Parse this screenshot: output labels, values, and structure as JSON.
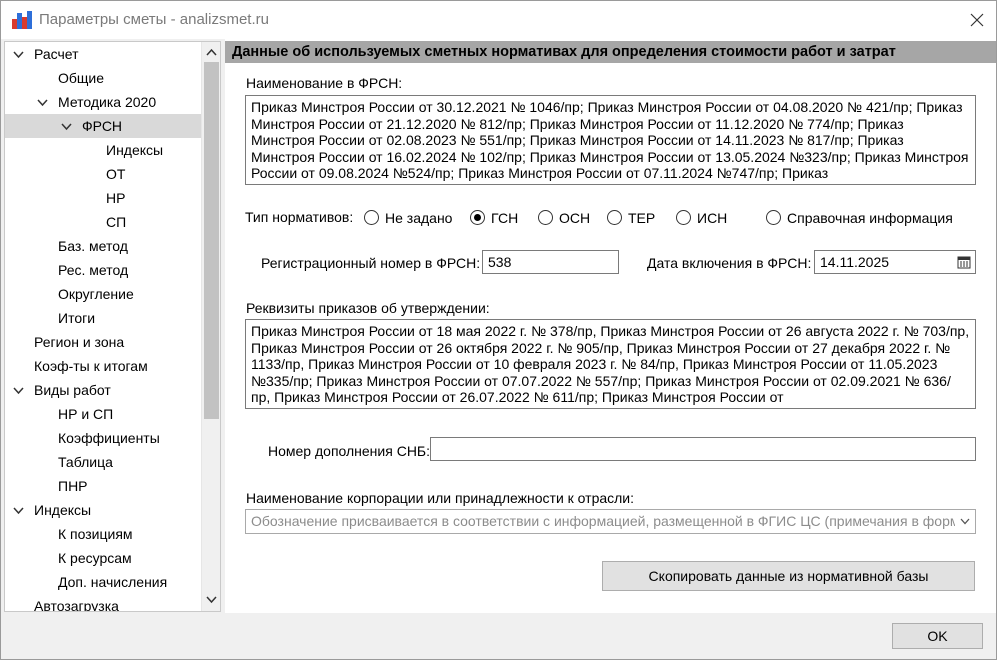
{
  "window": {
    "title": "Параметры сметы - analizsmet.ru"
  },
  "tree": {
    "items": [
      {
        "label": "Расчет",
        "level": 0,
        "expandable": true,
        "selected": false
      },
      {
        "label": "Общие",
        "level": 1,
        "expandable": false,
        "selected": false
      },
      {
        "label": "Методика 2020",
        "level": 1,
        "expandable": true,
        "selected": false
      },
      {
        "label": "ФРСН",
        "level": 2,
        "expandable": true,
        "selected": true
      },
      {
        "label": "Индексы",
        "level": 3,
        "expandable": false,
        "selected": false
      },
      {
        "label": "ОТ",
        "level": 3,
        "expandable": false,
        "selected": false
      },
      {
        "label": "НР",
        "level": 3,
        "expandable": false,
        "selected": false
      },
      {
        "label": "СП",
        "level": 3,
        "expandable": false,
        "selected": false
      },
      {
        "label": "Баз. метод",
        "level": 1,
        "expandable": false,
        "selected": false
      },
      {
        "label": "Рес. метод",
        "level": 1,
        "expandable": false,
        "selected": false
      },
      {
        "label": "Округление",
        "level": 1,
        "expandable": false,
        "selected": false
      },
      {
        "label": "Итоги",
        "level": 1,
        "expandable": false,
        "selected": false
      },
      {
        "label": "Регион и зона",
        "level": 0,
        "expandable": false,
        "selected": false
      },
      {
        "label": "Коэф-ты к итогам",
        "level": 0,
        "expandable": false,
        "selected": false
      },
      {
        "label": "Виды работ",
        "level": 0,
        "expandable": true,
        "selected": false
      },
      {
        "label": "НР и СП",
        "level": 1,
        "expandable": false,
        "selected": false
      },
      {
        "label": "Коэффициенты",
        "level": 1,
        "expandable": false,
        "selected": false
      },
      {
        "label": "Таблица",
        "level": 1,
        "expandable": false,
        "selected": false
      },
      {
        "label": "ПНР",
        "level": 1,
        "expandable": false,
        "selected": false
      },
      {
        "label": "Индексы",
        "level": 0,
        "expandable": true,
        "selected": false
      },
      {
        "label": "К позициям",
        "level": 1,
        "expandable": false,
        "selected": false
      },
      {
        "label": "К ресурсам",
        "level": 1,
        "expandable": false,
        "selected": false
      },
      {
        "label": "Доп. начисления",
        "level": 1,
        "expandable": false,
        "selected": false
      },
      {
        "label": "Автозагрузка",
        "level": 0,
        "expandable": false,
        "selected": false
      }
    ]
  },
  "panel": {
    "header": "Данные об используемых сметных нормативах для определения стоимости работ и затрат",
    "frsn_name_label": "Наименование в ФРСН:",
    "frsn_name_value": "Приказ Минстроя России от 30.12.2021 № 1046/пр; Приказ Минстроя России от 04.08.2020 № 421/пр; Приказ Минстроя России от 21.12.2020 № 812/пр; Приказ Минстроя России от 11.12.2020 № 774/пр; Приказ Минстроя России от 02.08.2023 № 551/пр; Приказ Минстроя России от 14.11.2023 № 817/пр; Приказ Минстроя России от 16.02.2024 № 102/пр; Приказ Минстроя России от 13.05.2024 №323/пр; Приказ Минстроя России от 09.08.2024 №524/пр; Приказ Минстроя России от 07.11.2024 №747/пр; Приказ",
    "norm_type_label": "Тип нормативов:",
    "norm_types": [
      {
        "label": "Не задано",
        "checked": false
      },
      {
        "label": "ГСН",
        "checked": true
      },
      {
        "label": "ОСН",
        "checked": false
      },
      {
        "label": "ТЕР",
        "checked": false
      },
      {
        "label": "ИСН",
        "checked": false
      },
      {
        "label": "Справочная информация",
        "checked": false
      }
    ],
    "reg_number_label": "Регистрационный номер в ФРСН:",
    "reg_number_value": "538",
    "date_label": "Дата включения в ФРСН:",
    "date_value": "14.11.2025",
    "orders_label": "Реквизиты приказов об утверждении:",
    "orders_value": "Приказ Минстроя России от 18 мая 2022 г. № 378/пр, Приказ Минстроя России от 26 августа 2022 г. № 703/пр, Приказ Минстроя России от 26 октября 2022 г. № 905/пр, Приказ Минстроя России от 27 декабря 2022 г. № 1133/пр, Приказ Минстроя России от 10 февраля 2023 г. № 84/пр, Приказ Минстроя России от 11.05.2023 №335/пр; Приказ Минстроя России от 07.07.2022 № 557/пр; Приказ Минстроя России от 02.09.2021 № 636/пр, Приказ Минстроя России от 26.07.2022 № 611/пр; Приказ Минстроя России от",
    "snb_label": "Номер дополнения СНБ:",
    "snb_value": "",
    "corp_label": "Наименование корпорации или принадлежности к отрасли:",
    "corp_placeholder": "Обозначение присваивается в соответствии с информацией, размещенной в ФГИС ЦС (примечания в форма",
    "copy_button": "Скопировать данные из нормативной базы"
  },
  "footer": {
    "ok_button": "OK"
  },
  "colors": {
    "panel_header_bg": "#a6a6a6",
    "selected_bg": "#d9d9d9",
    "window_bg": "#f0f0f0"
  }
}
